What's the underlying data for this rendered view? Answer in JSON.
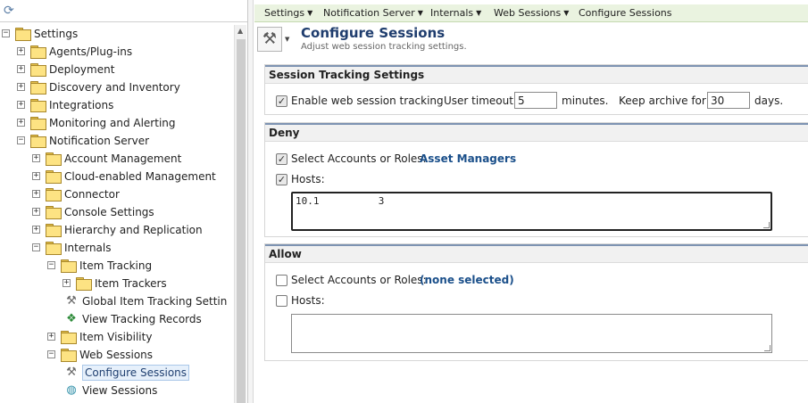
{
  "tree": {
    "nodes": [
      {
        "label": "Settings",
        "depth": 0,
        "expander": "−",
        "kind": "folder"
      },
      {
        "label": "Agents/Plug-ins",
        "depth": 1,
        "expander": "+",
        "kind": "folder"
      },
      {
        "label": "Deployment",
        "depth": 1,
        "expander": "+",
        "kind": "folder"
      },
      {
        "label": "Discovery and Inventory",
        "depth": 1,
        "expander": "+",
        "kind": "folder"
      },
      {
        "label": "Integrations",
        "depth": 1,
        "expander": "+",
        "kind": "folder"
      },
      {
        "label": "Monitoring and Alerting",
        "depth": 1,
        "expander": "+",
        "kind": "folder"
      },
      {
        "label": "Notification Server",
        "depth": 1,
        "expander": "−",
        "kind": "folder"
      },
      {
        "label": "Account Management",
        "depth": 2,
        "expander": "+",
        "kind": "folder"
      },
      {
        "label": "Cloud-enabled Management",
        "depth": 2,
        "expander": "+",
        "kind": "folder"
      },
      {
        "label": "Connector",
        "depth": 2,
        "expander": "+",
        "kind": "folder"
      },
      {
        "label": "Console Settings",
        "depth": 2,
        "expander": "+",
        "kind": "folder"
      },
      {
        "label": "Hierarchy and Replication",
        "depth": 2,
        "expander": "+",
        "kind": "folder"
      },
      {
        "label": "Internals",
        "depth": 2,
        "expander": "−",
        "kind": "folder"
      },
      {
        "label": "Item Tracking",
        "depth": 3,
        "expander": "−",
        "kind": "folder"
      },
      {
        "label": "Item Trackers",
        "depth": 4,
        "expander": "+",
        "kind": "folder"
      },
      {
        "label": "Global Item Tracking Settin",
        "depth": 4,
        "expander": "",
        "kind": "tools-icon"
      },
      {
        "label": "View Tracking Records",
        "depth": 4,
        "expander": "",
        "kind": "records-icon"
      },
      {
        "label": "Item Visibility",
        "depth": 3,
        "expander": "+",
        "kind": "folder"
      },
      {
        "label": "Web Sessions",
        "depth": 3,
        "expander": "−",
        "kind": "folder"
      },
      {
        "label": "Configure Sessions",
        "depth": 4,
        "expander": "",
        "kind": "tools-icon",
        "selected": true
      },
      {
        "label": "View Sessions",
        "depth": 4,
        "expander": "",
        "kind": "globe-icon"
      }
    ]
  },
  "breadcrumb": [
    {
      "label": "Settings",
      "dropdown": true
    },
    {
      "label": "Notification Server",
      "dropdown": true
    },
    {
      "label": "Internals",
      "dropdown": true
    },
    {
      "label": "Web Sessions",
      "dropdown": true
    },
    {
      "label": "Configure Sessions",
      "dropdown": false
    }
  ],
  "page": {
    "title": "Configure Sessions",
    "subtitle": "Adjust web session tracking settings."
  },
  "tracking": {
    "heading": "Session Tracking Settings",
    "enable_label": "Enable web session tracking",
    "enable_checked": true,
    "timeout_label": "User timeout:",
    "timeout_value": "5",
    "timeout_unit": "minutes.",
    "archive_label": "Keep archive for:",
    "archive_value": "30",
    "archive_unit": "days."
  },
  "deny": {
    "heading": "Deny",
    "accounts_label": "Select Accounts or Roles:",
    "accounts_checked": true,
    "accounts_value": "Asset Managers",
    "hosts_label": "Hosts:",
    "hosts_checked": true,
    "hosts_value": "10.1          3"
  },
  "allow": {
    "heading": "Allow",
    "accounts_label": "Select Accounts or Roles:",
    "accounts_checked": false,
    "accounts_value": "(none selected)",
    "hosts_label": "Hosts:",
    "hosts_checked": false,
    "hosts_value": ""
  },
  "colors": {
    "title": "#1f3d6e",
    "link": "#1a4f8a",
    "breadcrumb_bg": "#eaf3e0",
    "section_rule": "#7d93b2"
  }
}
